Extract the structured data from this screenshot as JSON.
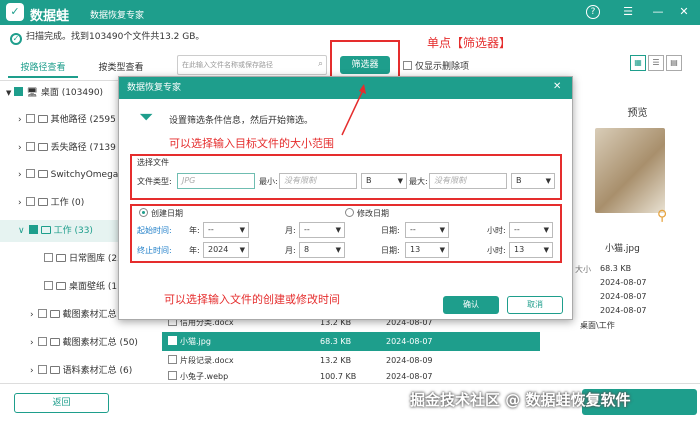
{
  "app": {
    "logo_text": "数据蛙",
    "name": "数据蛙",
    "subtitle": "数据恢复专家",
    "help_icon": "?",
    "min_icon": "—",
    "close_icon": "✕"
  },
  "status": {
    "text": "扫描完成。找到103490个文件共13.2 GB。"
  },
  "tabs": [
    {
      "label": "按路径查看"
    },
    {
      "label": "按类型查看"
    }
  ],
  "search": {
    "placeholder": "在此输入文件名称或保存路径"
  },
  "toolbar": {
    "filter_label": "筛选器",
    "show_deleted_label": "仅显示删除项"
  },
  "annotations": {
    "click_filter": "单点【筛选器】",
    "size_hint": "可以选择输入目标文件的大小范围",
    "time_hint": "可以选择输入文件的创建或修改时间"
  },
  "tree": [
    {
      "label": "桌面 (103490)"
    },
    {
      "label": "其他路径 (2595"
    },
    {
      "label": "丢失路径 (7139"
    },
    {
      "label": "SwitchyOmega"
    },
    {
      "label": "工作 (0)"
    },
    {
      "label": "工作 (33)"
    },
    {
      "label": "日常图库 (25)"
    },
    {
      "label": "桌面壁纸 (11)"
    },
    {
      "label": "截图素材汇总 (8)"
    },
    {
      "label": "截图素材汇总 (50)"
    },
    {
      "label": "语料素材汇总 (6)"
    }
  ],
  "dialog": {
    "title": "数据恢复专家",
    "description": "设置筛选条件信息，然后开始筛选。",
    "file_section": "选择文件",
    "file_type_label": "文件类型:",
    "file_type_placeholder": "JPG",
    "min_label": "最小:",
    "min_placeholder": "没有限制",
    "min_unit": "B",
    "max_label": "最大:",
    "max_placeholder": "没有限制",
    "max_unit": "B",
    "created_label": "创建日期",
    "modified_label": "修改日期",
    "start_label": "起始时间:",
    "end_label": "终止时间:",
    "year_label": "年:",
    "month_label": "月:",
    "day_label": "日期:",
    "hour_label": "小时:",
    "start": {
      "year": "--",
      "month": "--",
      "day": "--",
      "hour": "--"
    },
    "end": {
      "year": "2024",
      "month": "8",
      "day": "13",
      "hour": "13"
    },
    "ok_label": "确认",
    "cancel_label": "取消"
  },
  "files": [
    {
      "name": "信用分类.docx",
      "size": "13.2 KB",
      "date": "2024-08-07"
    },
    {
      "name": "小猫.jpg",
      "size": "68.3 KB",
      "date": "2024-08-07"
    },
    {
      "name": "片段记录.docx",
      "size": "13.2 KB",
      "date": "2024-08-09"
    },
    {
      "name": "小兔子.webp",
      "size": "100.7 KB",
      "date": "2024-08-07"
    }
  ],
  "preview": {
    "title": "预览",
    "filename": "小猫.jpg",
    "details": [
      "68.3 KB",
      "2024-08-07",
      "2024-08-07",
      "2024-08-07"
    ],
    "detail_labels": [
      "大小",
      "",
      "",
      ""
    ],
    "path": "桌面\\工作"
  },
  "footer": {
    "back_label": "返回",
    "watermark": "掘金技术社区 @ 数据蛙恢复软件"
  },
  "colors": {
    "brand": "#1e9e8c",
    "annotation": "#e52d2d"
  }
}
